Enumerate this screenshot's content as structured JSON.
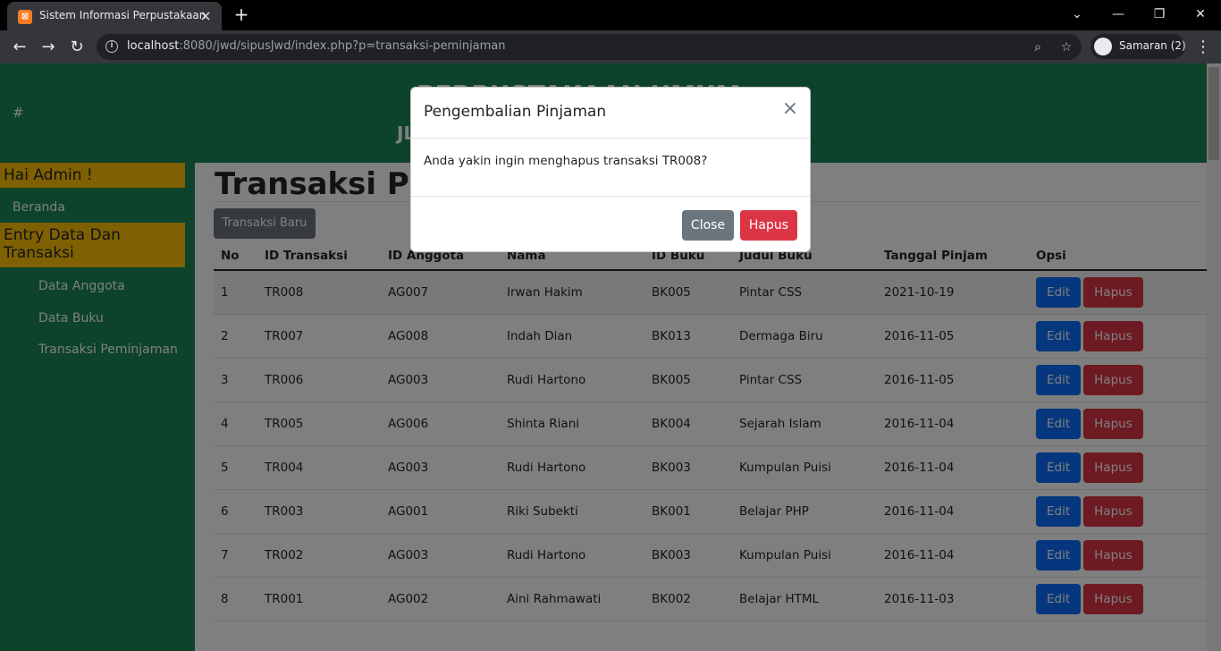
{
  "browser": {
    "tab_title": "Sistem Informasi Perpustakaan",
    "tab_close_icon": "×",
    "new_tab_icon": "+",
    "url_host": "localhost",
    "url_rest": ":8080/jwd/sipusJwd/index.php?p=transaksi-peminjaman",
    "profile_label": "Samaran (2)",
    "win_controls": {
      "dropdown": "⌄",
      "minimize": "—",
      "restore": "❐",
      "close": "✕"
    },
    "nav": {
      "back": "←",
      "forward": "→",
      "reload": "↻"
    },
    "zoom_icon": "⌕",
    "star_icon": "☆",
    "menu_icon": "⋮"
  },
  "header": {
    "hash": "#",
    "title": "PERPUSTAKAAN UMUM",
    "subtitle": "JL"
  },
  "sidebar": {
    "greeting": "Hai Admin !",
    "home": "Beranda",
    "section": "Entry Data Dan Transaksi",
    "items": [
      "Data Anggota",
      "Data Buku",
      "Transaksi Peminjaman"
    ]
  },
  "main": {
    "title": "Transaksi Pem",
    "new_button": "Transaksi Baru",
    "columns": [
      "No",
      "ID Transaksi",
      "ID Anggota",
      "Nama",
      "ID Buku",
      "Judul Buku",
      "Tanggal Pinjam",
      "Opsi"
    ],
    "rows": [
      [
        "1",
        "TR008",
        "AG007",
        "Irwan Hakim",
        "BK005",
        "Pintar CSS",
        "2021-10-19"
      ],
      [
        "2",
        "TR007",
        "AG008",
        "Indah Dian",
        "BK013",
        "Dermaga Biru",
        "2016-11-05"
      ],
      [
        "3",
        "TR006",
        "AG003",
        "Rudi Hartono",
        "BK005",
        "Pintar CSS",
        "2016-11-05"
      ],
      [
        "4",
        "TR005",
        "AG006",
        "Shinta Riani",
        "BK004",
        "Sejarah Islam",
        "2016-11-04"
      ],
      [
        "5",
        "TR004",
        "AG003",
        "Rudi Hartono",
        "BK003",
        "Kumpulan Puisi",
        "2016-11-04"
      ],
      [
        "6",
        "TR003",
        "AG001",
        "Riki Subekti",
        "BK001",
        "Belajar PHP",
        "2016-11-04"
      ],
      [
        "7",
        "TR002",
        "AG003",
        "Rudi Hartono",
        "BK003",
        "Kumpulan Puisi",
        "2016-11-04"
      ],
      [
        "8",
        "TR001",
        "AG002",
        "Aini Rahmawati",
        "BK002",
        "Belajar HTML",
        "2016-11-03"
      ]
    ],
    "edit_label": "Edit",
    "delete_label": "Hapus"
  },
  "modal": {
    "title": "Pengembalian Pinjaman",
    "close_icon": "×",
    "message": "Anda yakin ingin menghapus transaksi TR008?",
    "close_button": "Close",
    "confirm_button": "Hapus"
  },
  "colors": {
    "brand_green": "#198754",
    "sidebar_heading": "#ffc107",
    "primary": "#0d6efd",
    "danger": "#dc3545",
    "secondary": "#6c757d"
  }
}
